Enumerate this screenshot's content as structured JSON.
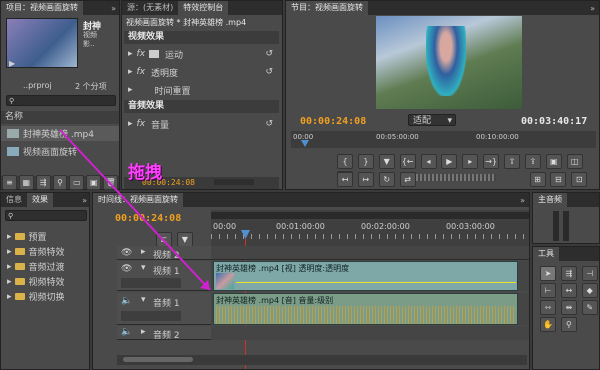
{
  "project": {
    "tab_title": "项目：视频画面旋转",
    "clip_name": "封神",
    "clip_info": "视频\n影..",
    "project_file": "..prproj",
    "item_count": "2 个分项",
    "col_name": "名称",
    "items": [
      "封神英雄榜 .mp4",
      "视频画面旋转"
    ]
  },
  "effect_controls": {
    "tab_source": "源：(无素材)",
    "tab_effect": "特效控制台",
    "seq_title": "视频画面旋转 * 封神英雄榜 .mp4",
    "video_effects": "视频效果",
    "motion": "运动",
    "opacity": "透明度",
    "time_remap": "时间重置",
    "audio_effects": "音频效果",
    "volume": "音量",
    "time": "00:00:24:08"
  },
  "program": {
    "tab_title": "节目：视频画面旋转",
    "timecode": "00:00:24:08",
    "fit": "适配",
    "duration": "00:03:40:17",
    "ruler": [
      "00:00",
      "00:05:00:00",
      "00:10:00:00"
    ]
  },
  "annotation": "拖拽",
  "effects_panel": {
    "tab_info": "信息",
    "tab_effects": "效果",
    "items": [
      "预置",
      "音频特效",
      "音频过渡",
      "视频特效",
      "视频切换"
    ]
  },
  "timeline": {
    "tab_title": "时间线：视频画面旋转",
    "timecode": "00:00:24:08",
    "ruler": [
      "00:00",
      "00:01:00:00",
      "00:02:00:00",
      "00:03:00:00"
    ],
    "video2": "视频 2",
    "video1": "视频 1",
    "audio1": "音频 1",
    "audio2": "音频 2",
    "video_clip": "封神英雄榜 .mp4 [视] 透明度:透明度",
    "audio_clip": "封神英雄榜 .mp4 [音] 音量:级别"
  },
  "master_audio": {
    "title": "主音频"
  },
  "tools": {
    "title": "工具"
  },
  "colors": {
    "accent": "#f0a020",
    "arrow": "#d020d0",
    "clip_video": "#7ea7a8",
    "clip_audio": "#7b9d88",
    "playhead": "#d03030"
  }
}
